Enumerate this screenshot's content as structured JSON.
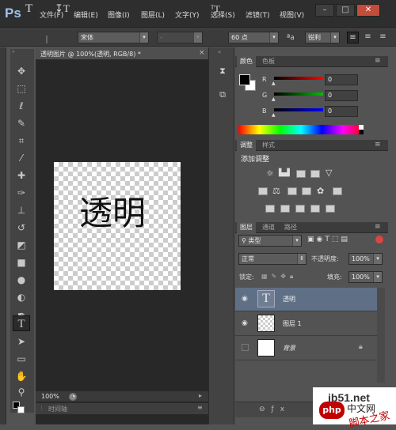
{
  "app": {
    "logo": "Ps",
    "menu": [
      "文件(F)",
      "编辑(E)",
      "图像(I)",
      "图层(L)",
      "文字(Y)",
      "选择(S)",
      "滤镜(T)",
      "视图(V)"
    ],
    "window_buttons": [
      "–",
      "□",
      "✕"
    ]
  },
  "options_bar": {
    "font_family": "宋体",
    "font_style": "-",
    "font_size": "60 点",
    "aa_label": "ªa",
    "antialias": "锐利"
  },
  "document": {
    "tab_label": "透明图片 @ 100%(透明, RGB/8) *",
    "close": "×",
    "canvas_text": "透明",
    "zoom": "100%",
    "timeline_label": "时间轴"
  },
  "color_panel": {
    "tabs": [
      "颜色",
      "色板"
    ],
    "channels": [
      {
        "label": "R",
        "value": "0",
        "color": "#ff0000"
      },
      {
        "label": "G",
        "value": "0",
        "color": "#00c000"
      },
      {
        "label": "B",
        "value": "0",
        "color": "#0000ff"
      }
    ]
  },
  "adjust_panel": {
    "tabs": [
      "调整",
      "样式"
    ],
    "title": "添加调整"
  },
  "layers_panel": {
    "tabs": [
      "图层",
      "通道",
      "路径"
    ],
    "filter": "类型",
    "blend_mode": "正常",
    "opacity_label": "不透明度:",
    "opacity": "100%",
    "lock_label": "锁定:",
    "fill_label": "填充:",
    "fill": "100%",
    "layers": [
      {
        "name": "透明",
        "kind": "text",
        "selected": true
      },
      {
        "name": "图层 1",
        "kind": "transparent",
        "selected": false
      },
      {
        "name": "背景",
        "kind": "background",
        "selected": false
      }
    ]
  },
  "watermark": {
    "site": "jb51.net",
    "brand": "php",
    "brand_suffix": "中文网",
    "cn": "脚本之家"
  },
  "colors": {
    "accent_selection": "#5f6f86",
    "arrow": "#e02020"
  }
}
